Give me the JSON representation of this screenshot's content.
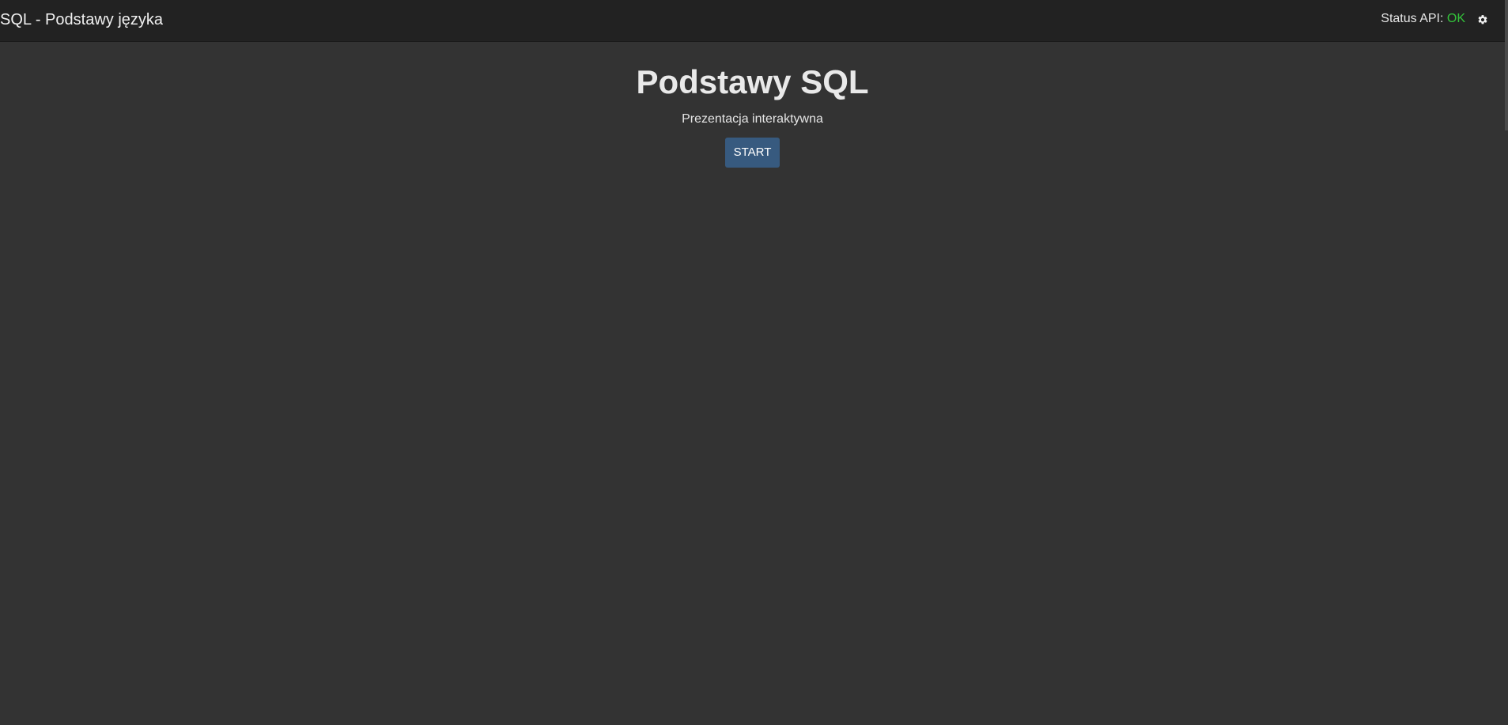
{
  "navbar": {
    "brand": "SQL - Podstawy języka",
    "status_label": "Status API:",
    "status_value": "OK",
    "status_color": "#33c23a",
    "settings_icon": "gear-icon"
  },
  "hero": {
    "title": "Podstawy SQL",
    "subtitle": "Prezentacja interaktywna",
    "start_label": "START"
  },
  "colors": {
    "background": "#333333",
    "navbar": "#222222",
    "primary": "#375a7f"
  }
}
